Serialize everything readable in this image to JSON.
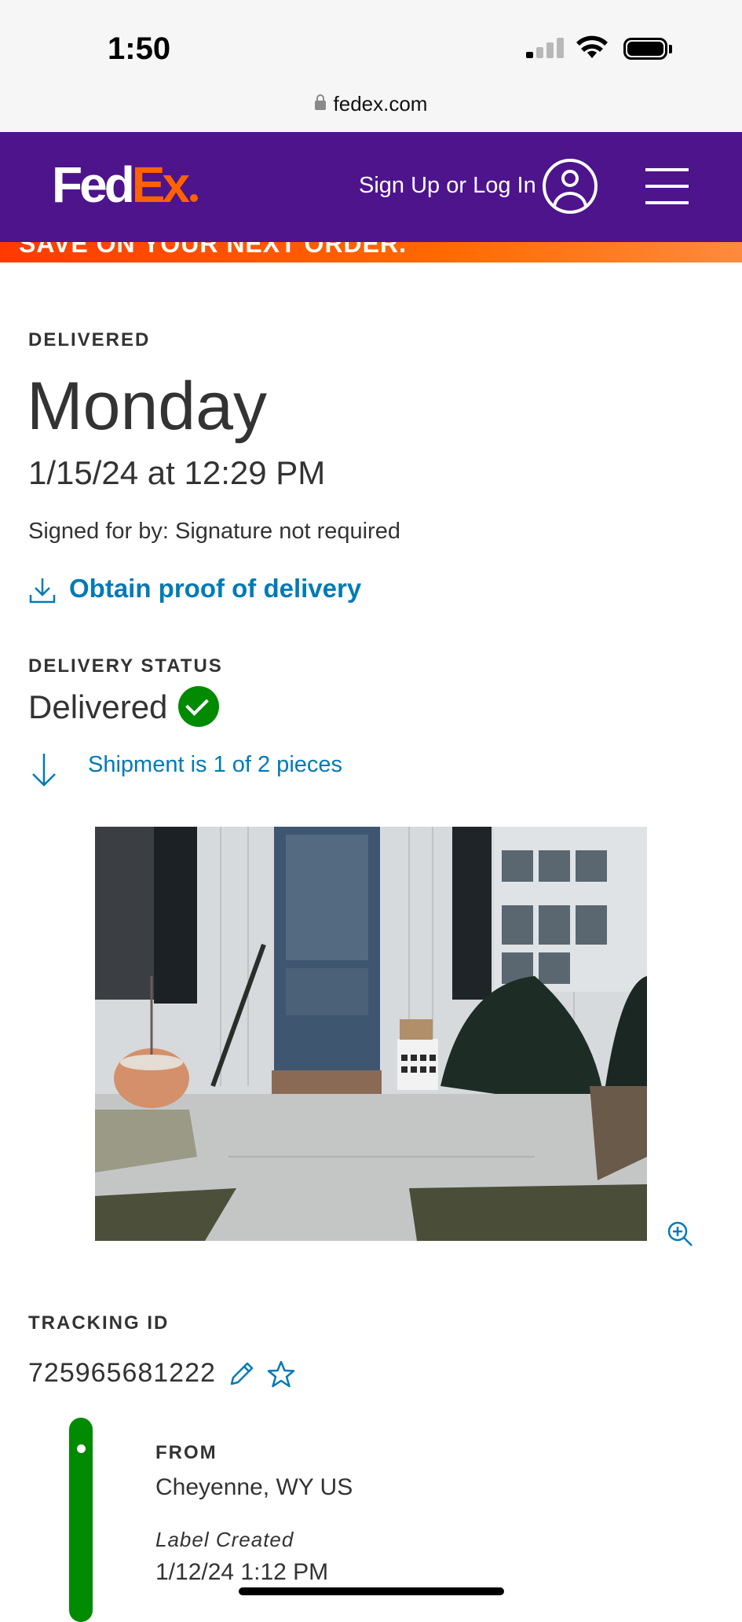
{
  "status_bar": {
    "time": "1:50",
    "url": "fedex.com"
  },
  "header": {
    "logo_fed": "Fed",
    "logo_ex": "Ex",
    "signin": "Sign Up or Log In"
  },
  "promo": {
    "text": "SAVE ON YOUR NEXT ORDER."
  },
  "delivery": {
    "status_label": "DELIVERED",
    "day": "Monday",
    "datetime": "1/15/24 at 12:29 PM",
    "signed_for": "Signed for by: Signature not required",
    "proof_link": "Obtain proof of delivery"
  },
  "delivery_status": {
    "label": "DELIVERY STATUS",
    "value": "Delivered",
    "shipment": "Shipment is 1 of 2 pieces"
  },
  "tracking": {
    "label": "TRACKING ID",
    "id": "725965681222",
    "from_label": "FROM",
    "from_city": "Cheyenne, WY US",
    "event": "Label Created",
    "event_date": "1/12/24 1:12 PM"
  },
  "colors": {
    "brand_purple": "#4d148c",
    "brand_orange": "#ff6200",
    "link_blue": "#007ab7",
    "success_green": "#008a00"
  },
  "icons": [
    "lock-icon",
    "user-icon",
    "menu-icon",
    "download-icon",
    "check-icon",
    "arrow-down-icon",
    "zoom-in-icon",
    "pencil-icon",
    "star-icon"
  ]
}
